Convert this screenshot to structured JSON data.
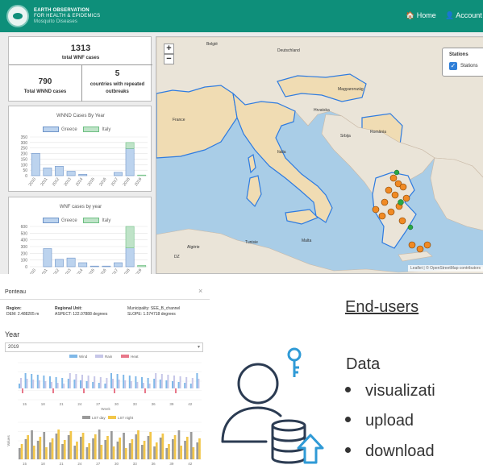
{
  "header": {
    "brand_line1": "EARTH OBSERVATION",
    "brand_line2": "FOR HEALTH & EPIDEMICS",
    "brand_line3": "Mosquito Diseases",
    "nav_home": "🏠 Home",
    "nav_account": "👤 Account ▾"
  },
  "stats": {
    "total_wnf": "1313",
    "total_wnf_label": "total WNF cases",
    "total_wnnd": "790",
    "total_wnnd_label": "Total WNND cases",
    "repeated": "5",
    "repeated_label": "countries with repeated outbreaks"
  },
  "legend": {
    "greece": "Greece",
    "italy": "Italy"
  },
  "chart_data": [
    {
      "type": "bar",
      "title": "WNND Cases By Year",
      "categories": [
        "2010",
        "2011",
        "2012",
        "2013",
        "2014",
        "2015",
        "2016",
        "2017",
        "2018",
        "2019"
      ],
      "series": [
        {
          "name": "Greece",
          "values": [
            202,
            70,
            85,
            40,
            12,
            0,
            0,
            30,
            245,
            0
          ]
        },
        {
          "name": "Italy",
          "values": [
            0,
            0,
            0,
            0,
            0,
            0,
            0,
            0,
            55,
            6
          ]
        }
      ],
      "yticks": [
        "0",
        "50",
        "100",
        "150",
        "200",
        "250",
        "300",
        "350"
      ],
      "ylim": [
        0,
        350
      ]
    },
    {
      "type": "bar",
      "title": "WNF cases by year",
      "categories": [
        "2010",
        "2011",
        "2012",
        "2013",
        "2014",
        "2015",
        "2016",
        "2017",
        "2018",
        "2019"
      ],
      "series": [
        {
          "name": "Greece",
          "values": [
            0,
            270,
            110,
            130,
            60,
            10,
            10,
            60,
            280,
            0
          ]
        },
        {
          "name": "Italy",
          "values": [
            0,
            0,
            0,
            0,
            0,
            0,
            0,
            0,
            320,
            20
          ]
        }
      ],
      "yticks": [
        "0",
        "100",
        "200",
        "300",
        "400",
        "500",
        "600"
      ],
      "ylim": [
        0,
        600
      ]
    },
    {
      "type": "bar",
      "categories": [
        "15",
        "18",
        "21",
        "24",
        "27",
        "30",
        "33",
        "36",
        "39",
        "42"
      ],
      "legend": [
        "Wind",
        "Rain",
        "Heat"
      ],
      "xlabel": "Week"
    },
    {
      "type": "bar",
      "categories": [
        "15",
        "18",
        "21",
        "24",
        "27",
        "30",
        "33",
        "36",
        "39",
        "42"
      ],
      "legend": [
        "LST day",
        "LST night"
      ],
      "ylabel": "Values"
    }
  ],
  "map": {
    "zoom_in": "+",
    "zoom_out": "−",
    "stations_title": "Stations",
    "stations_label": "Stations",
    "attribution": "Leaflet | © OpenStreetMap contributors",
    "labels": {
      "belgie": "België",
      "deutschland": "Deutschland",
      "italia": "Italia",
      "france": "France",
      "magyarorszag": "Magyarország",
      "romania": "România",
      "hrvatska": "Hrvatska",
      "srbija": "Srbija",
      "tunisie": "Tunisie",
      "algerie": "Algérie",
      "malta": "Malta",
      "dz": "DZ"
    }
  },
  "detail": {
    "title": "Ponteau",
    "close": "×",
    "region_label": "Region:",
    "region_dem": "DEM: 2.488205 m",
    "unit_label": "Regional Unit:",
    "unit_aspect": "ASPECT: 122.07888 degrees",
    "muni_label": "Municipality: SEE_B_channel",
    "muni_slope": "SLOPE: 1.574718 degrees",
    "year_label": "Year",
    "year_value": "2019"
  },
  "side": {
    "endusers": "End-users",
    "data": "Data",
    "bullets": [
      "visualizati",
      "upload",
      "download"
    ]
  }
}
